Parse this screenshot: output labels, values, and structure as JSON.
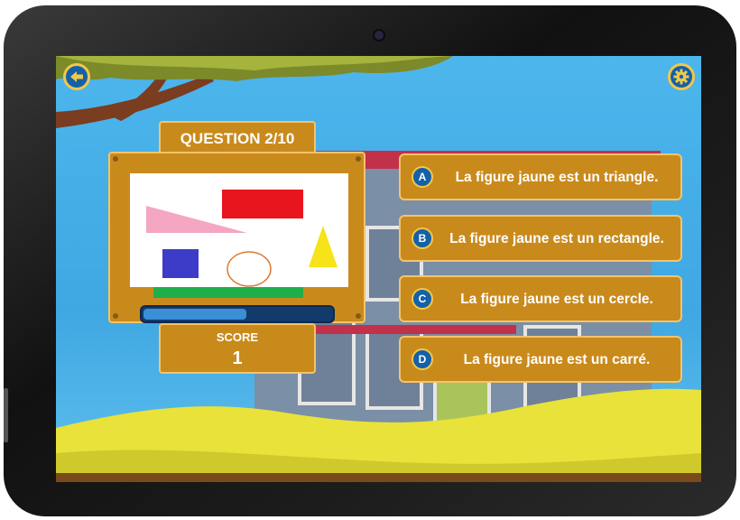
{
  "game": {
    "question_label": "QUESTION 2/10",
    "score_label": "SCORE",
    "score_value": "1",
    "progress_fraction": 0.55,
    "answers": [
      {
        "letter": "A",
        "text": "La figure jaune est un triangle."
      },
      {
        "letter": "B",
        "text": "La figure jaune est un rectangle."
      },
      {
        "letter": "C",
        "text": "La figure jaune est un cercle."
      },
      {
        "letter": "D",
        "text": "La figure jaune est un carré."
      }
    ],
    "shapes": [
      "red-rectangle",
      "pink-triangle",
      "yellow-triangle",
      "blue-square",
      "orange-circle-outline",
      "green-bar"
    ]
  },
  "icons": {
    "back": "back-arrow-icon",
    "settings": "gear-icon"
  },
  "colors": {
    "panel": "#c98a1c",
    "panel_border": "#f3c46b",
    "button_blue": "#1561a8",
    "sky": "#3fa7e2",
    "grass": "#e8e23a"
  }
}
